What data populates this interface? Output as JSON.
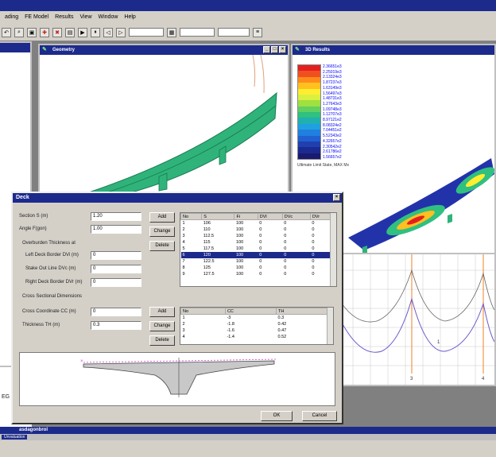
{
  "menubar": {
    "items": [
      "ading",
      "FE Model",
      "Results",
      "View",
      "Window",
      "Help"
    ]
  },
  "windows": {
    "geometry": {
      "title": "Geometry"
    },
    "results3d": {
      "title": "3D Results",
      "caption": "Ultimate Limit State, MAX Mx"
    },
    "chart": {
      "labels": [
        "1",
        "3",
        "4"
      ]
    },
    "left_label": "EG"
  },
  "legend": {
    "colors": [
      "#e32020",
      "#f05020",
      "#ff8c1a",
      "#ffc020",
      "#ffee30",
      "#d9f040",
      "#a0e040",
      "#60d060",
      "#30c080",
      "#20b0b0",
      "#20a0e0",
      "#2080e0",
      "#2060d0",
      "#2040b0",
      "#1a2a90",
      "#1a1a70"
    ],
    "labels": [
      "2.36651e3",
      "2.25019e3",
      "2.13324e3",
      "1.87237e3",
      "1.63149e3",
      "1.56497e3",
      "1.48731e3",
      "1.27643e3",
      "1.09748e3",
      "1.12707e3",
      "8.97121e2",
      "8.08324e2",
      "7.04451e2",
      "5.52343e2",
      "4.32657e2",
      "2.30542e2",
      "2.61786e2",
      "1.56657e2"
    ]
  },
  "dialog": {
    "title": "Deck",
    "section_label": "Section S (m)",
    "section_value": "1.20",
    "angle_label": "Angle F(gon)",
    "angle_value": "1.00",
    "overburden_heading": "Overburden Thickness at",
    "left_label": "Left Deck Border DVi (m)",
    "left_value": "0",
    "stake_label": "Stake Out Line DVc (m)",
    "stake_value": "0",
    "right_label": "Right Deck Border DVr (m)",
    "right_value": "0",
    "cross_heading": "Cross Sectional Dimensions",
    "cc_label": "Cross Coordinate CC (m)",
    "cc_value": "0",
    "th_label": "Thickness TH (m)",
    "th_value": "0.3",
    "add_label": "Add",
    "change_label": "Change",
    "delete_label": "Delete",
    "ok_label": "OK",
    "cancel_label": "Cancel",
    "grid1": {
      "headers": [
        "No",
        "S",
        "Fi",
        "DVl",
        "DVc",
        "DVr"
      ],
      "rows": [
        [
          "1",
          "106",
          "100",
          "0",
          "0",
          "0"
        ],
        [
          "2",
          "110",
          "100",
          "0",
          "0",
          "0"
        ],
        [
          "3",
          "112.5",
          "100",
          "0",
          "0",
          "0"
        ],
        [
          "4",
          "115",
          "100",
          "0",
          "0",
          "0"
        ],
        [
          "5",
          "117.5",
          "100",
          "0",
          "0",
          "0"
        ],
        [
          "6",
          "120",
          "100",
          "0",
          "0",
          "0"
        ],
        [
          "7",
          "122.5",
          "100",
          "0",
          "0",
          "0"
        ],
        [
          "8",
          "125",
          "100",
          "0",
          "0",
          "0"
        ],
        [
          "9",
          "127.5",
          "100",
          "0",
          "0",
          "0"
        ]
      ]
    },
    "grid2": {
      "headers": [
        "No",
        "CC",
        "TH"
      ],
      "rows": [
        [
          "1",
          "-3",
          "0.3"
        ],
        [
          "2",
          "-1.8",
          "0.42"
        ],
        [
          "3",
          "-1.6",
          "0.47"
        ],
        [
          "4",
          "-1.4",
          "0.52"
        ]
      ]
    }
  },
  "status": {
    "line1": "asdagonbrol",
    "line2": "Unvaluation"
  }
}
